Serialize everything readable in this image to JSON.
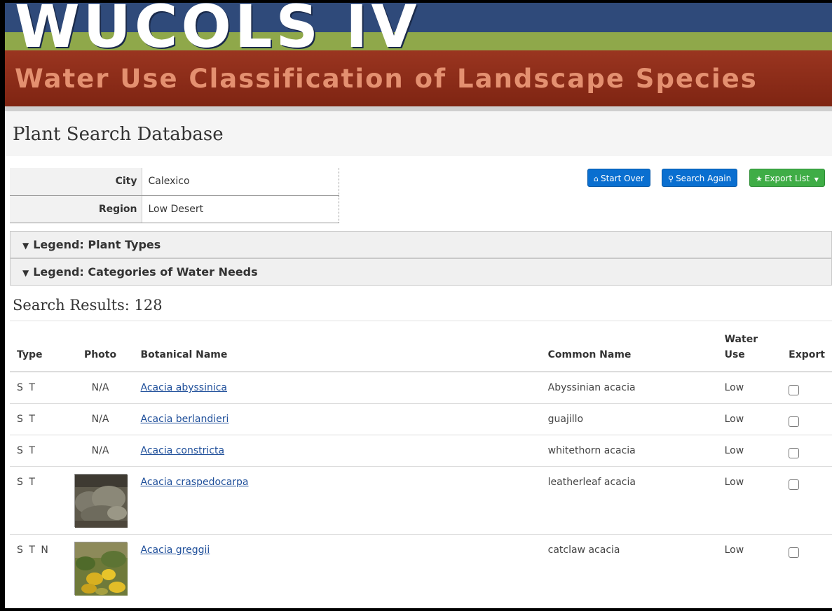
{
  "banner": {
    "title": "WUCOLS IV",
    "subtitle": "Water Use Classification of Landscape Species"
  },
  "page": {
    "title": "Plant Search Database"
  },
  "location": {
    "city_label": "City",
    "city_value": "Calexico",
    "region_label": "Region",
    "region_value": "Low Desert"
  },
  "buttons": {
    "start_over": "Start Over",
    "search_again": "Search Again",
    "export_list": "Export List"
  },
  "icons": {
    "start_over": "home-icon",
    "search_again": "search-icon",
    "export_list": "star-icon",
    "export_caret": "caret-down-icon",
    "legend_toggle": "triangle-down-icon"
  },
  "legends": [
    {
      "label": "Legend: Plant Types"
    },
    {
      "label": "Legend: Categories of Water Needs"
    }
  ],
  "results": {
    "title": "Search Results: 128",
    "columns": {
      "type": "Type",
      "photo": "Photo",
      "botanical": "Botanical Name",
      "common": "Common Name",
      "water_1": "Water",
      "water_2": "Use",
      "export": "Export"
    },
    "rows": [
      {
        "type": "S T",
        "photo": "N/A",
        "botanical": "Acacia abyssinica",
        "common": "Abyssinian acacia",
        "water": "Low"
      },
      {
        "type": "S T",
        "photo": "N/A",
        "botanical": "Acacia berlandieri",
        "common": "guajillo",
        "water": "Low"
      },
      {
        "type": "S T",
        "photo": "N/A",
        "botanical": "Acacia constricta",
        "common": "whitethorn acacia",
        "water": "Low"
      },
      {
        "type": "S T",
        "photo": "",
        "botanical": "Acacia craspedocarpa",
        "common": "leatherleaf acacia",
        "water": "Low"
      },
      {
        "type": "S T N",
        "photo": "",
        "botanical": "Acacia greggii",
        "common": "catclaw acacia",
        "water": "Low"
      }
    ]
  },
  "colors": {
    "banner_blue": "#2f4a7a",
    "banner_green": "#8fa84a",
    "banner_red": "#8a2a14",
    "button_blue": "#0a6fd0",
    "button_green": "#3fad46",
    "link": "#1f4f9a"
  }
}
